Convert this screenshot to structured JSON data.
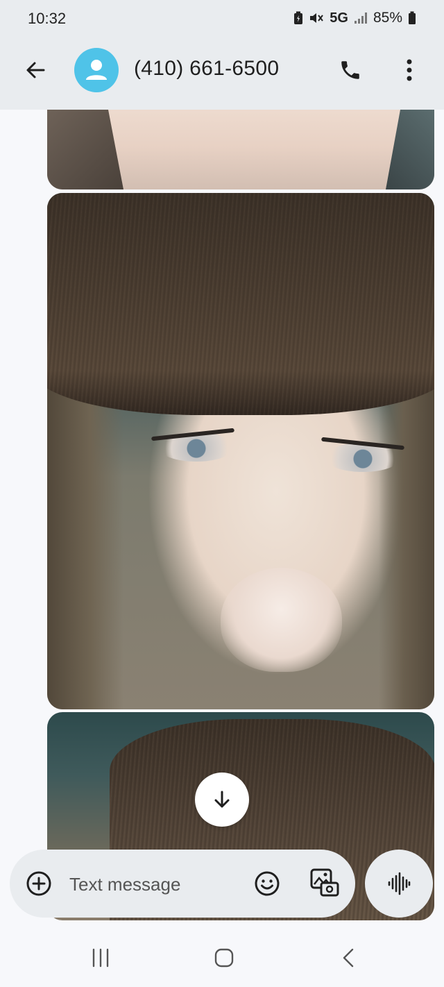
{
  "status_bar": {
    "time": "10:32",
    "network": "5G",
    "battery": "85%",
    "icons": [
      "battery-saver-icon",
      "mute-icon",
      "signal-icon",
      "battery-icon"
    ]
  },
  "header": {
    "contact": "(410) 661-6500",
    "avatar_color": "#4fc3e8",
    "icons": [
      "back-arrow-icon",
      "person-icon",
      "phone-icon",
      "more-vert-icon"
    ]
  },
  "thread": {
    "attachments": [
      {
        "type": "photo",
        "subject": "partial"
      },
      {
        "type": "photo",
        "subject": "portrait"
      },
      {
        "type": "photo",
        "subject": "partial"
      }
    ],
    "scroll_icon": "arrow-down-icon"
  },
  "composer": {
    "placeholder": "Text message",
    "icons": [
      "add-circle-icon",
      "emoji-icon",
      "gallery-camera-icon",
      "voice-wave-icon"
    ]
  },
  "nav_bar": {
    "icons": [
      "recents-icon",
      "home-icon",
      "back-icon"
    ]
  },
  "colors": {
    "header_bg": "#e9ecef",
    "page_bg": "#f7f8fb",
    "accent": "#4fc3e8"
  }
}
